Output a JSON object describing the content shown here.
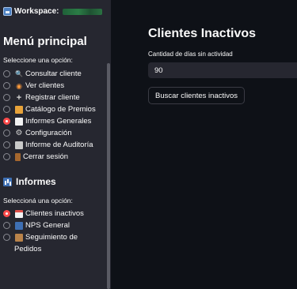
{
  "sidebar": {
    "workspace_label": "Workspace:",
    "menu_title": "Menú principal",
    "menu_prompt": "Seleccione una opción:",
    "menu_items": [
      {
        "label": "Consultar cliente",
        "icon": "magnifier-icon",
        "selected": false
      },
      {
        "label": "Ver clientes",
        "icon": "eye-icon",
        "selected": false
      },
      {
        "label": "Registrar cliente",
        "icon": "plus-icon",
        "selected": false
      },
      {
        "label": "Catálogo de Premios",
        "icon": "gift-icon",
        "selected": false
      },
      {
        "label": "Informes Generales",
        "icon": "document-icon",
        "selected": true
      },
      {
        "label": "Configuración",
        "icon": "gear-icon",
        "selected": false
      },
      {
        "label": "Informe de Auditoría",
        "icon": "clipboard-icon",
        "selected": false
      },
      {
        "label": "Cerrar sesión",
        "icon": "door-icon",
        "selected": false
      }
    ],
    "section_title": "Informes",
    "section_icon": "bar-chart-icon",
    "section_prompt": "Seleccioná una opción:",
    "report_items": [
      {
        "label": "Clientes inactivos",
        "icon": "calendar-icon",
        "selected": true
      },
      {
        "label": "NPS General",
        "icon": "bar-chart-icon",
        "selected": false
      },
      {
        "label": "Seguimiento de",
        "label_line2": "Pedidos",
        "icon": "package-icon",
        "selected": false
      }
    ]
  },
  "main": {
    "title": "Clientes Inactivos",
    "input_label": "Cantidad de días sin actividad",
    "input_value": "90",
    "button_label": "Buscar clientes inactivos"
  },
  "colors": {
    "background": "#0e1117",
    "sidebar": "#262730",
    "accent": "#ff4b4b",
    "text": "#fafafa"
  }
}
